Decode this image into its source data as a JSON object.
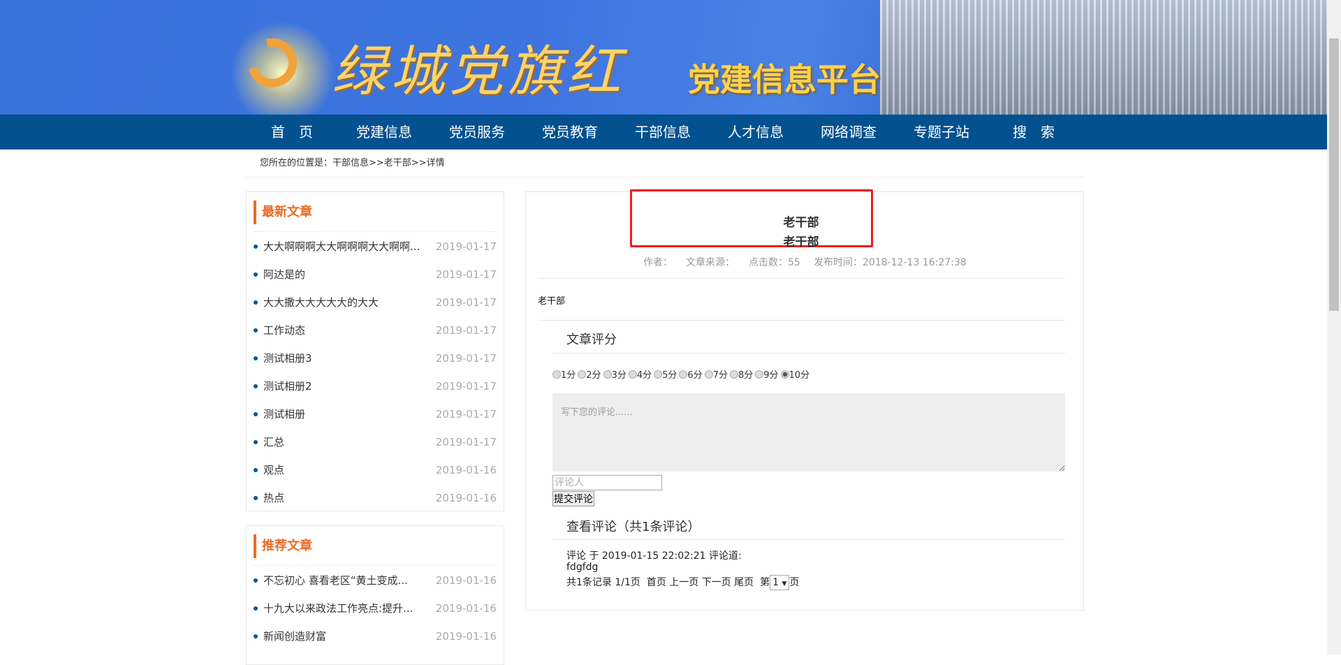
{
  "banner": {
    "site_title": "绿城党旗红",
    "subtitle": "党建信息平台"
  },
  "nav": [
    "首　页",
    "党建信息",
    "党员服务",
    "党员教育",
    "干部信息",
    "人才信息",
    "网络调查",
    "专题子站",
    "搜　索"
  ],
  "breadcrumb": "您所在的位置是：干部信息>>老干部>>详情",
  "latest": {
    "title": "最新文章",
    "items": [
      {
        "title": "大大啊啊啊大大啊啊啊大大啊啊...",
        "date": "2019-01-17"
      },
      {
        "title": "阿达是的",
        "date": "2019-01-17"
      },
      {
        "title": "大大撒大大大大大的大大",
        "date": "2019-01-17"
      },
      {
        "title": "工作动态",
        "date": "2019-01-17"
      },
      {
        "title": "测试相册3",
        "date": "2019-01-17"
      },
      {
        "title": "测试相册2",
        "date": "2019-01-17"
      },
      {
        "title": "测试相册",
        "date": "2019-01-17"
      },
      {
        "title": "汇总",
        "date": "2019-01-17"
      },
      {
        "title": "观点",
        "date": "2019-01-16"
      },
      {
        "title": "热点",
        "date": "2019-01-16"
      }
    ]
  },
  "recommended": {
    "title": "推荐文章",
    "items": [
      {
        "title": "不忘初心 喜看老区“黄土变成...",
        "date": "2019-01-16"
      },
      {
        "title": "十九大以来政法工作亮点:提升...",
        "date": "2019-01-16"
      },
      {
        "title": "新闻创造财富",
        "date": "2019-01-16"
      }
    ]
  },
  "article": {
    "title1": "老干部",
    "title2": "老干部",
    "meta": {
      "author": "作者：",
      "source": "文章来源：",
      "clicks": "点击数：55",
      "published": "发布时间：2018-12-13 16:27:38"
    },
    "body": "老干部"
  },
  "rating": {
    "heading": "文章评分",
    "options": [
      "1分",
      "2分",
      "3分",
      "4分",
      "5分",
      "6分",
      "7分",
      "8分",
      "9分",
      "10分"
    ],
    "selected": "10分"
  },
  "comment_form": {
    "placeholder": "写下您的评论......",
    "name_placeholder": "评论人",
    "submit": "提交评论"
  },
  "comments": {
    "heading": "查看评论（共1条评论）",
    "items": [
      {
        "header": "评论 于 2019-01-15 22:02:21 评论道:",
        "text": "fdgfdg"
      }
    ],
    "pager": {
      "summary": "共1条记录 1/1页",
      "first": "首页",
      "prev": "上一页",
      "next": "下一页",
      "last": "尾页",
      "page_prefix": "第",
      "page": "1",
      "page_suffix": "页"
    }
  }
}
